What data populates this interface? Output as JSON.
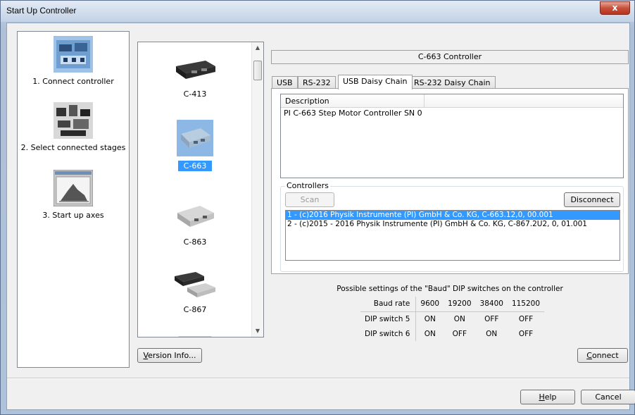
{
  "window": {
    "title": "Start Up Controller",
    "close_label": "x"
  },
  "steps": [
    {
      "label": "1. Connect controller",
      "icon": "controller-photo-icon"
    },
    {
      "label": "2. Select connected stages",
      "icon": "stages-photo-icon"
    },
    {
      "label": "3. Start up axes",
      "icon": "plot-window-icon"
    }
  ],
  "devices": [
    {
      "name": "C-413"
    },
    {
      "name": "C-663",
      "selected": true
    },
    {
      "name": "C-863"
    },
    {
      "name": "C-867"
    }
  ],
  "controller_title": "C-663 Controller",
  "tabs": [
    {
      "label": "USB"
    },
    {
      "label": "RS-232"
    },
    {
      "label": "USB Daisy Chain",
      "active": true
    },
    {
      "label": "RS-232 Daisy Chain"
    }
  ],
  "description": {
    "header": "Description",
    "rows": [
      "PI C-663 Step Motor Controller SN 0"
    ]
  },
  "controllers": {
    "group_label": "Controllers",
    "scan_label": "Scan",
    "disconnect_label": "Disconnect",
    "items": [
      {
        "text": "1 - (c)2016 Physik Instrumente (PI) GmbH & Co. KG, C-663.12,0, 00.001",
        "selected": true
      },
      {
        "text": "2 - (c)2015 - 2016 Physik Instrumente (PI) GmbH & Co. KG, C-867.2U2, 0, 01.001",
        "selected": false
      }
    ]
  },
  "baud": {
    "caption": "Possible settings of the \"Baud\" DIP switches on the controller",
    "header": [
      "Baud rate",
      "9600",
      "19200",
      "38400",
      "115200"
    ],
    "rows": [
      [
        "DIP switch 5",
        "ON",
        "ON",
        "OFF",
        "OFF"
      ],
      [
        "DIP switch 6",
        "ON",
        "OFF",
        "ON",
        "OFF"
      ]
    ]
  },
  "buttons": {
    "version_info": {
      "mnemonic": "V",
      "rest": "ersion Info..."
    },
    "connect": {
      "mnemonic": "C",
      "rest": "onnect"
    },
    "help": {
      "mnemonic": "H",
      "rest": "elp"
    },
    "cancel": "Cancel"
  }
}
